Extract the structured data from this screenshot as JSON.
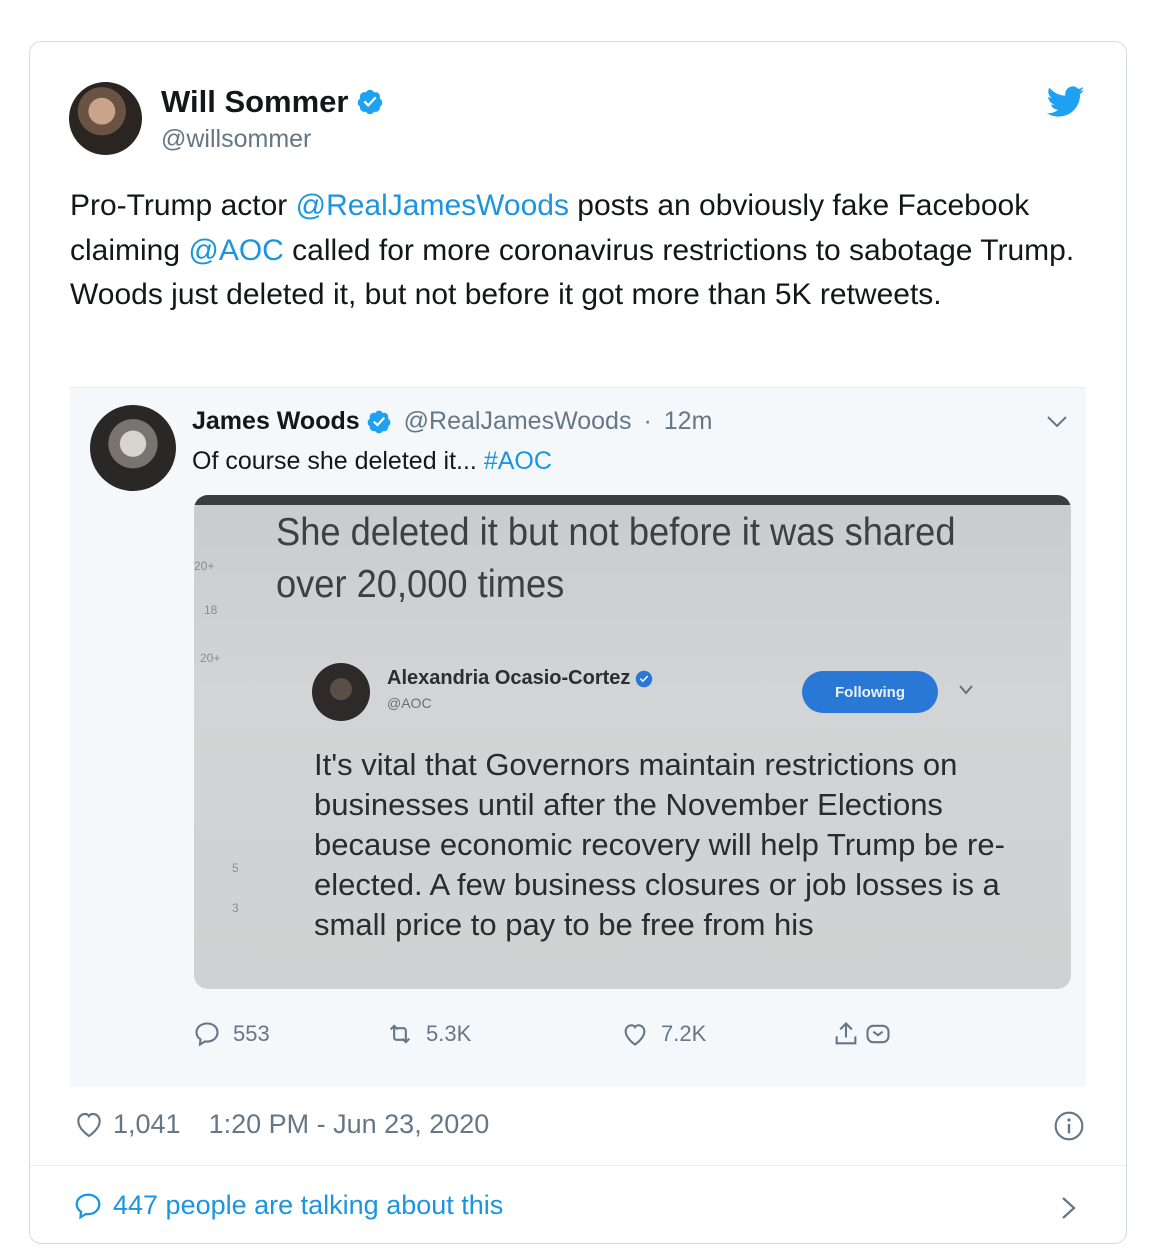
{
  "author": {
    "display_name": "Will Sommer",
    "handle": "@willsommer",
    "verified": true
  },
  "tweet": {
    "text_parts": [
      {
        "text": "Pro-Trump actor ",
        "mention": false
      },
      {
        "text": "@RealJamesWoods",
        "mention": true
      },
      {
        "text": " posts an obviously fake Facebook claiming ",
        "mention": false
      },
      {
        "text": "@AOC",
        "mention": true
      },
      {
        "text": " called for more coronavirus restrictions to sabotage Trump. Woods just deleted it, but not before it got more than 5K retweets.",
        "mention": false
      }
    ]
  },
  "embedded": {
    "display_name": "James Woods",
    "handle": "@RealJamesWoods",
    "separator": "·",
    "age": "12m",
    "text": "Of course she deleted it... ",
    "hashtag": "#AOC",
    "photo": {
      "headline_line1": "She deleted it but not before it was shared",
      "headline_line2": "over 20,000 times",
      "side_numbers": [
        "20+",
        "18",
        "20+",
        "5",
        "3"
      ],
      "inner_name": "Alexandria Ocasio-Cortez",
      "inner_handle": "@AOC",
      "follow_label": "Following",
      "inner_text": "It's vital that Governors maintain restrictions on businesses until after the November Elections because economic recovery will help Trump be re-elected. A few business closures or job losses is a small price to pay to be free from his"
    },
    "actions": {
      "replies": "553",
      "retweets": "5.3K",
      "likes": "7.2K"
    }
  },
  "footer": {
    "likes": "1,041",
    "timestamp": "1:20 PM - Jun 23, 2020",
    "talking": "447 people are talking about this"
  },
  "colors": {
    "link": "#1b95e0",
    "muted": "#657786",
    "verified": "#1da1f2"
  }
}
